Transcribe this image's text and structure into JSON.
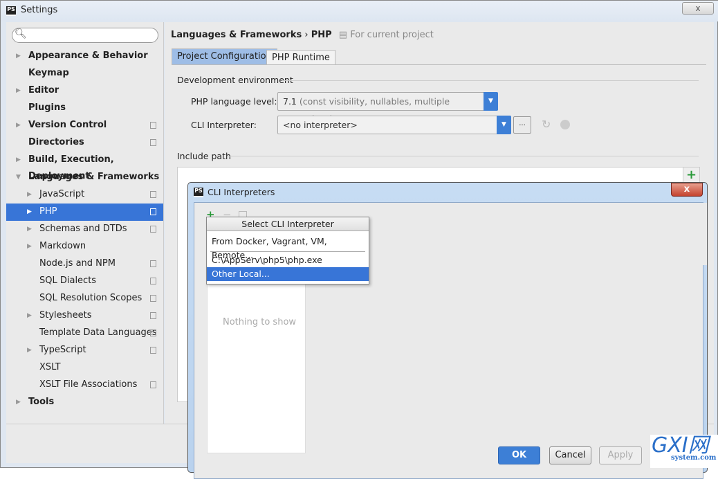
{
  "window": {
    "title": "Settings",
    "close": "x"
  },
  "search": {
    "placeholder": ""
  },
  "sidebar": {
    "items": [
      {
        "label": "Appearance & Behavior",
        "bold": true,
        "arrow": "right",
        "level": 0
      },
      {
        "label": "Keymap",
        "bold": true,
        "level": 0
      },
      {
        "label": "Editor",
        "bold": true,
        "arrow": "right",
        "level": 0
      },
      {
        "label": "Plugins",
        "bold": true,
        "level": 0
      },
      {
        "label": "Version Control",
        "bold": true,
        "arrow": "right",
        "level": 0,
        "copy": true
      },
      {
        "label": "Directories",
        "bold": true,
        "level": 0,
        "copy": true
      },
      {
        "label": "Build, Execution, Deployment",
        "bold": true,
        "arrow": "right",
        "level": 0
      },
      {
        "label": "Languages & Frameworks",
        "bold": true,
        "arrow": "down",
        "level": 0
      },
      {
        "label": "JavaScript",
        "arrow": "right",
        "level": 1,
        "copy": true
      },
      {
        "label": "PHP",
        "arrow": "right",
        "level": 1,
        "copy": true,
        "selected": true
      },
      {
        "label": "Schemas and DTDs",
        "arrow": "right",
        "level": 1,
        "copy": true
      },
      {
        "label": "Markdown",
        "arrow": "right",
        "level": 1
      },
      {
        "label": "Node.js and NPM",
        "level": 1,
        "copy": true
      },
      {
        "label": "SQL Dialects",
        "level": 1,
        "copy": true
      },
      {
        "label": "SQL Resolution Scopes",
        "level": 1,
        "copy": true
      },
      {
        "label": "Stylesheets",
        "arrow": "right",
        "level": 1,
        "copy": true
      },
      {
        "label": "Template Data Languages",
        "level": 1,
        "copy": true
      },
      {
        "label": "TypeScript",
        "arrow": "right",
        "level": 1,
        "copy": true
      },
      {
        "label": "XSLT",
        "level": 1
      },
      {
        "label": "XSLT File Associations",
        "level": 1,
        "copy": true
      },
      {
        "label": "Tools",
        "bold": true,
        "arrow": "right",
        "level": 0
      }
    ]
  },
  "breadcrumb": {
    "section": "Languages & Frameworks",
    "sep": "›",
    "page": "PHP",
    "scope": "For current project"
  },
  "tabs": [
    {
      "label": "Project Configuration",
      "active": true
    },
    {
      "label": "PHP Runtime"
    }
  ],
  "dev_env": {
    "title": "Development environment",
    "lang_label": "PHP language level:",
    "lang_value": "7.1",
    "lang_desc": "(const visibility, nullables, multiple exceptions)",
    "cli_label": "CLI Interpreter:",
    "cli_value": "<no interpreter>",
    "browse": "..."
  },
  "include_path": {
    "title": "Include path",
    "add": "+"
  },
  "cli_dialog": {
    "title": "CLI Interpreters",
    "close": "x",
    "empty": "Nothing to show",
    "add": "+",
    "remove": "−"
  },
  "popup": {
    "title": "Select CLI Interpreter",
    "items": [
      "From Docker, Vagrant, VM, Remote...",
      "C:\\AppServ\\php5\\php.exe",
      "Other Local..."
    ],
    "selected": 2
  },
  "buttons": {
    "ok": "OK",
    "cancel": "Cancel",
    "apply": "Apply"
  },
  "watermark": {
    "text": "GXI网",
    "sub": "system.com"
  },
  "colors": {
    "accent": "#3875d7",
    "ok": "#3d7fd6"
  }
}
